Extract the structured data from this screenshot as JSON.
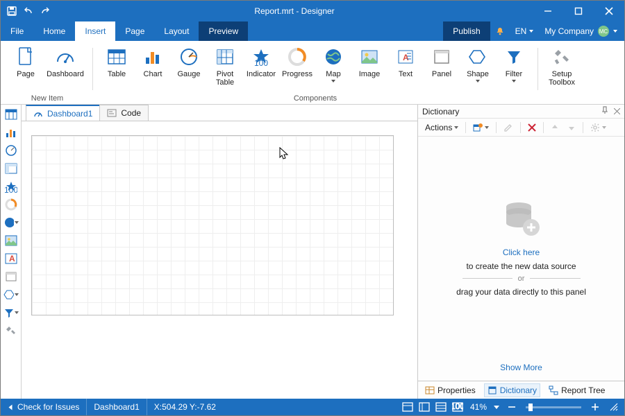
{
  "titlebar": {
    "title": "Report.mrt - Designer"
  },
  "menubar": {
    "items": [
      "File",
      "Home",
      "Insert",
      "Page",
      "Layout",
      "Preview"
    ],
    "publish": "Publish",
    "language": "EN",
    "company": "My Company",
    "avatar_initials": "MC"
  },
  "ribbon": {
    "group_new_item": "New Item",
    "new_item": [
      "Page",
      "Dashboard"
    ],
    "group_components": "Components",
    "components": [
      "Table",
      "Chart",
      "Gauge",
      "Pivot\nTable",
      "Indicator",
      "Progress",
      "Map",
      "Image",
      "Text",
      "Panel",
      "Shape",
      "Filter"
    ],
    "setup": [
      "Setup\nToolbox"
    ]
  },
  "doctabs": [
    {
      "label": "Dashboard1"
    },
    {
      "label": "Code"
    }
  ],
  "dictionary": {
    "title": "Dictionary",
    "actions_label": "Actions",
    "empty": {
      "click_here": "Click here",
      "line1": "to create the new data source",
      "or": "or",
      "line2": "drag your data directly to this panel"
    },
    "show_more": "Show More",
    "tabs": [
      "Properties",
      "Dictionary",
      "Report Tree"
    ]
  },
  "status": {
    "check": "Check for Issues",
    "page": "Dashboard1",
    "coords": "X:504.29 Y:-7.62",
    "zoom": "41%"
  }
}
